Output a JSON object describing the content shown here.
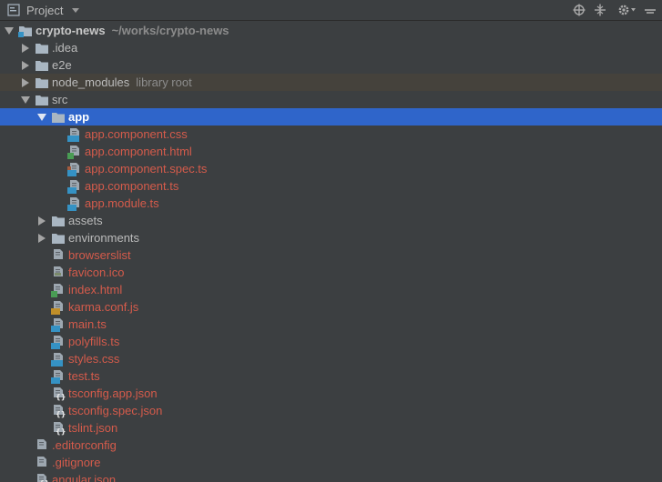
{
  "header": {
    "title": "Project",
    "icons": [
      "project-view-icon",
      "dropdown-caret-icon",
      "locate-target-icon",
      "collapse-all-icon",
      "settings-gear-icon",
      "hide-panel-icon"
    ]
  },
  "tree": [
    {
      "label": "crypto-news",
      "hint": "~/works/crypto-news",
      "icon": "module-folder-icon",
      "expanded": true,
      "depth": 0
    },
    {
      "label": ".idea",
      "icon": "folder-icon",
      "expanded": false,
      "depth": 1
    },
    {
      "label": "e2e",
      "icon": "folder-icon",
      "expanded": false,
      "depth": 1
    },
    {
      "label": "node_modules",
      "hint": "library root",
      "icon": "folder-icon",
      "expanded": false,
      "depth": 1
    },
    {
      "label": "src",
      "icon": "folder-icon",
      "expanded": true,
      "depth": 1
    },
    {
      "label": "app",
      "icon": "folder-icon",
      "expanded": true,
      "depth": 2
    },
    {
      "label": "app.component.css",
      "icon": "css-file-icon",
      "badge": "CSS",
      "depth": 3
    },
    {
      "label": "app.component.html",
      "icon": "html-file-icon",
      "badge": "H",
      "depth": 3
    },
    {
      "label": "app.component.spec.ts",
      "icon": "typescript-spec-file-icon",
      "badge": "TS",
      "depth": 3
    },
    {
      "label": "app.component.ts",
      "icon": "typescript-file-icon",
      "badge": "TS",
      "depth": 3
    },
    {
      "label": "app.module.ts",
      "icon": "typescript-file-icon",
      "badge": "TS",
      "depth": 3
    },
    {
      "label": "assets",
      "icon": "folder-icon",
      "expanded": false,
      "depth": 2
    },
    {
      "label": "environments",
      "icon": "folder-icon",
      "expanded": false,
      "depth": 2
    },
    {
      "label": "browserslist",
      "icon": "text-file-icon",
      "depth": 2
    },
    {
      "label": "favicon.ico",
      "icon": "image-file-icon",
      "depth": 2
    },
    {
      "label": "index.html",
      "icon": "html-file-icon",
      "badge": "H",
      "depth": 2
    },
    {
      "label": "karma.conf.js",
      "icon": "javascript-file-icon",
      "badge": "JS",
      "depth": 2
    },
    {
      "label": "main.ts",
      "icon": "typescript-file-icon",
      "badge": "TS",
      "depth": 2
    },
    {
      "label": "polyfills.ts",
      "icon": "typescript-file-icon",
      "badge": "TS",
      "depth": 2
    },
    {
      "label": "styles.css",
      "icon": "css-file-icon",
      "badge": "CSS",
      "depth": 2
    },
    {
      "label": "test.ts",
      "icon": "typescript-file-icon",
      "badge": "TS",
      "depth": 2
    },
    {
      "label": "tsconfig.app.json",
      "icon": "json-file-icon",
      "depth": 2
    },
    {
      "label": "tsconfig.spec.json",
      "icon": "json-file-icon",
      "depth": 2
    },
    {
      "label": "tslint.json",
      "icon": "json-file-icon",
      "depth": 2
    },
    {
      "label": ".editorconfig",
      "icon": "text-file-icon",
      "depth": 1
    },
    {
      "label": ".gitignore",
      "icon": "text-file-icon",
      "depth": 1
    },
    {
      "label": "angular.json",
      "icon": "json-file-icon",
      "depth": 1
    }
  ],
  "colors": {
    "background": "#3c3f41",
    "selection": "#2f65ca",
    "library_row": "#45423c",
    "changed_file_text": "#d55b4b",
    "folder": "#a9b6c2"
  }
}
